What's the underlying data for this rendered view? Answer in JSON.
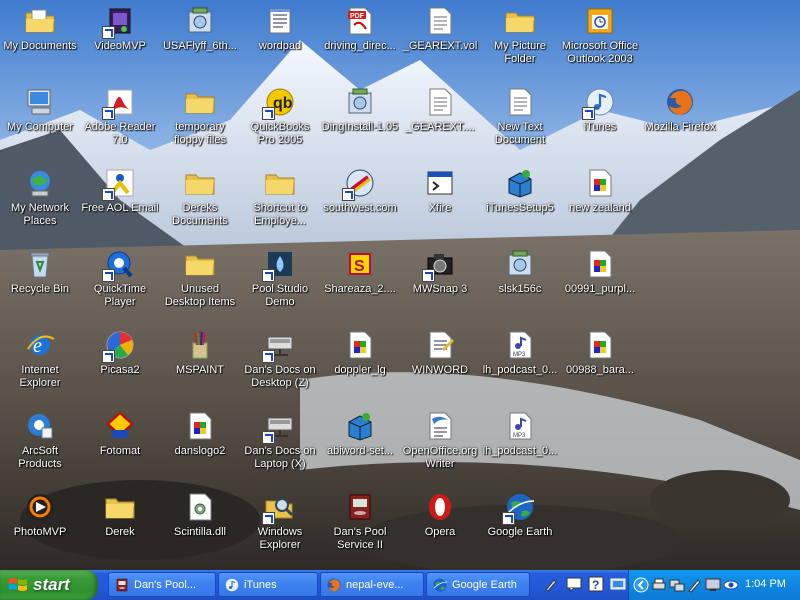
{
  "desktop": {
    "icons": [
      {
        "label": "My Documents",
        "icon": "documents-folder-icon",
        "col": 0,
        "row": 0
      },
      {
        "label": "VideoMVP",
        "icon": "video-app-icon",
        "col": 1,
        "row": 0
      },
      {
        "label": "USAFlyff_6th...",
        "icon": "installer-icon",
        "col": 2,
        "row": 0
      },
      {
        "label": "wordpad",
        "icon": "wordpad-icon",
        "col": 3,
        "row": 0
      },
      {
        "label": "driving_direc...",
        "icon": "pdf-document-icon",
        "col": 4,
        "row": 0
      },
      {
        "label": "_GEAREXT.vol",
        "icon": "text-document-icon",
        "col": 5,
        "row": 0
      },
      {
        "label": "My Picture Folder",
        "icon": "folder-icon",
        "col": 6,
        "row": 0
      },
      {
        "label": "Microsoft Office Outlook 2003",
        "icon": "outlook-calendar-icon",
        "col": 7,
        "row": 0
      },
      {
        "label": "My Computer",
        "icon": "computer-icon",
        "col": 0,
        "row": 1
      },
      {
        "label": "Adobe Reader 7.0",
        "icon": "adobe-reader-icon",
        "col": 1,
        "row": 1
      },
      {
        "label": "temporary floppy files",
        "icon": "folder-icon",
        "col": 2,
        "row": 1
      },
      {
        "label": "QuickBooks Pro 2005",
        "icon": "quickbooks-icon",
        "col": 3,
        "row": 1
      },
      {
        "label": "DingInstall-1.05",
        "icon": "installer-icon",
        "col": 4,
        "row": 1
      },
      {
        "label": "_GEAREXT....",
        "icon": "text-document-icon",
        "col": 5,
        "row": 1
      },
      {
        "label": "New Text Document",
        "icon": "text-document-icon",
        "col": 6,
        "row": 1
      },
      {
        "label": "iTunes",
        "icon": "itunes-icon",
        "col": 7,
        "row": 1
      },
      {
        "label": "Mozilla Firefox",
        "icon": "firefox-icon",
        "col": 8,
        "row": 1
      },
      {
        "label": "My Network Places",
        "icon": "network-places-icon",
        "col": 0,
        "row": 2
      },
      {
        "label": "Free AOL Email",
        "icon": "aol-icon",
        "col": 1,
        "row": 2
      },
      {
        "label": "Dereks Documents",
        "icon": "folder-icon",
        "col": 2,
        "row": 2
      },
      {
        "label": "Shortcut to Employe...",
        "icon": "folder-icon",
        "col": 3,
        "row": 2
      },
      {
        "label": "southwest.com",
        "icon": "southwest-icon",
        "col": 4,
        "row": 2
      },
      {
        "label": "Xfire",
        "icon": "application-window-icon",
        "col": 5,
        "row": 2
      },
      {
        "label": "iTunesSetup5",
        "icon": "setup-package-icon",
        "col": 6,
        "row": 2
      },
      {
        "label": "new zealand",
        "icon": "image-file-icon",
        "col": 7,
        "row": 2
      },
      {
        "label": "Recycle Bin",
        "icon": "recycle-bin-icon",
        "col": 0,
        "row": 3
      },
      {
        "label": "QuickTime Player",
        "icon": "quicktime-icon",
        "col": 1,
        "row": 3
      },
      {
        "label": "Unused Desktop Items",
        "icon": "folder-icon",
        "col": 2,
        "row": 3
      },
      {
        "label": "Pool Studio Demo",
        "icon": "pool-studio-icon",
        "col": 3,
        "row": 3
      },
      {
        "label": "Shareaza_2....",
        "icon": "shareaza-icon",
        "col": 4,
        "row": 3
      },
      {
        "label": "MWSnap 3",
        "icon": "camera-icon",
        "col": 5,
        "row": 3
      },
      {
        "label": "slsk156c",
        "icon": "installer-icon",
        "col": 6,
        "row": 3
      },
      {
        "label": "00991_purpl...",
        "icon": "image-file-icon",
        "col": 7,
        "row": 3
      },
      {
        "label": "Internet Explorer",
        "icon": "internet-explorer-icon",
        "col": 0,
        "row": 4
      },
      {
        "label": "Picasa2",
        "icon": "picasa-icon",
        "col": 1,
        "row": 4
      },
      {
        "label": "MSPAINT",
        "icon": "paint-icon",
        "col": 2,
        "row": 4
      },
      {
        "label": "Dan's Docs on Desktop (Z)",
        "icon": "network-drive-icon",
        "col": 3,
        "row": 4
      },
      {
        "label": "doppler_lg",
        "icon": "image-file-icon",
        "col": 4,
        "row": 4
      },
      {
        "label": "WINWORD",
        "icon": "word-document-icon",
        "col": 5,
        "row": 4
      },
      {
        "label": "lh_podcast_0...",
        "icon": "mp3-file-icon",
        "col": 6,
        "row": 4
      },
      {
        "label": "00988_bara...",
        "icon": "image-file-icon",
        "col": 7,
        "row": 4
      },
      {
        "label": "ArcSoft Products",
        "icon": "arcsoft-icon",
        "col": 0,
        "row": 5
      },
      {
        "label": "Fotomat",
        "icon": "fotomat-icon",
        "col": 1,
        "row": 5
      },
      {
        "label": "danslogo2",
        "icon": "image-file-icon",
        "col": 2,
        "row": 5
      },
      {
        "label": "Dan's Docs on Laptop (X)",
        "icon": "network-drive-icon",
        "col": 3,
        "row": 5
      },
      {
        "label": "abiword-set...",
        "icon": "setup-package-icon",
        "col": 4,
        "row": 5
      },
      {
        "label": "OpenOffice.org Writer",
        "icon": "openoffice-writer-icon",
        "col": 5,
        "row": 5
      },
      {
        "label": "lh_podcast_0...",
        "icon": "mp3-file-icon",
        "col": 6,
        "row": 5
      },
      {
        "label": "PhotoMVP",
        "icon": "photomvp-icon",
        "col": 0,
        "row": 6
      },
      {
        "label": "Derek",
        "icon": "folder-icon",
        "col": 1,
        "row": 6
      },
      {
        "label": "Scintilla.dll",
        "icon": "dll-file-icon",
        "col": 2,
        "row": 6
      },
      {
        "label": "Windows Explorer",
        "icon": "windows-explorer-icon",
        "col": 3,
        "row": 6
      },
      {
        "label": "Dan's Pool Service II",
        "icon": "database-icon",
        "col": 4,
        "row": 6
      },
      {
        "label": "Opera",
        "icon": "opera-icon",
        "col": 5,
        "row": 6
      },
      {
        "label": "Google Earth",
        "icon": "google-earth-icon",
        "col": 6,
        "row": 6
      }
    ]
  },
  "taskbar": {
    "start_label": "start",
    "tasks": [
      {
        "label": "Dan's Pool...",
        "icon": "database-icon"
      },
      {
        "label": "iTunes",
        "icon": "itunes-icon"
      },
      {
        "label": "nepal-eve...",
        "icon": "firefox-icon"
      },
      {
        "label": "Google Earth",
        "icon": "google-earth-icon"
      }
    ],
    "quick_launch": [
      "pen-tool-icon",
      "chat-icon",
      "help-icon",
      "show-desktop-icon"
    ],
    "tray_icons": [
      "tray-expand-icon",
      "tray-printer-icon",
      "tray-network-icon",
      "tray-pen-icon",
      "tray-monitor-icon",
      "tray-eye-icon"
    ],
    "clock": "1:04 PM"
  }
}
